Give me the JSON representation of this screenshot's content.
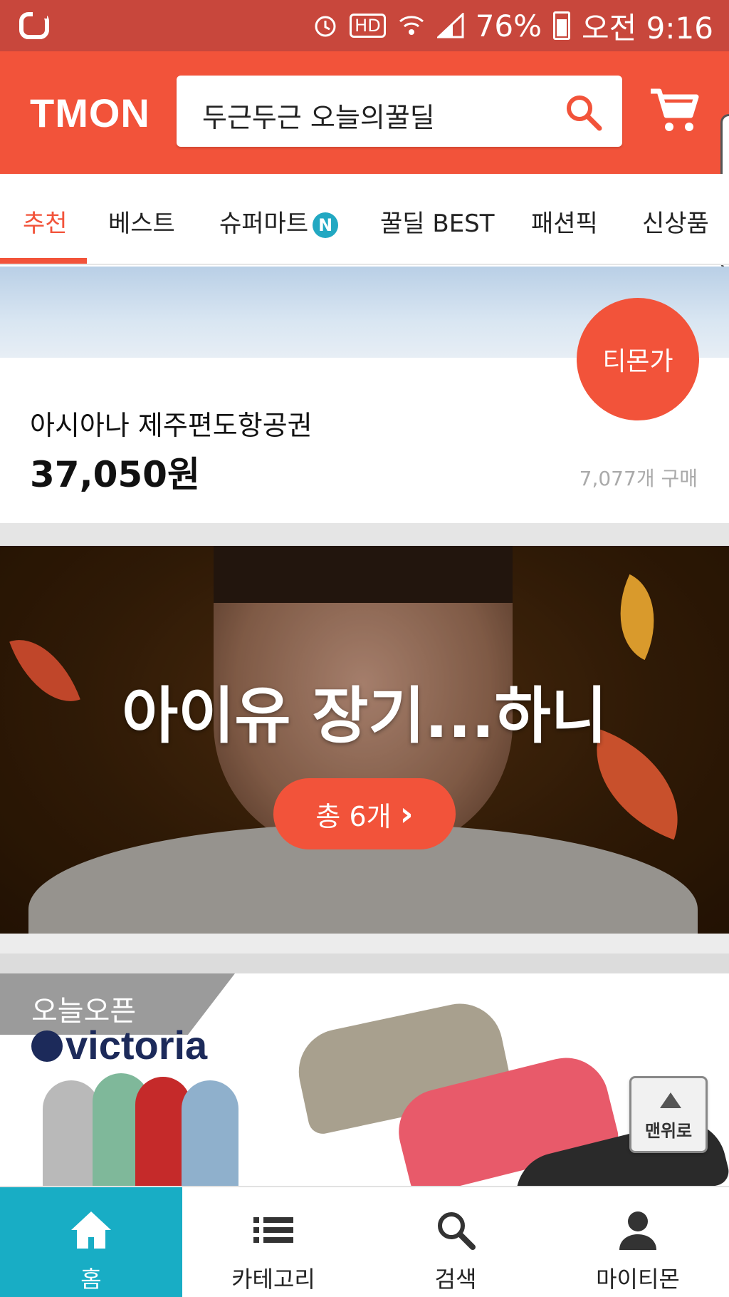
{
  "status_bar": {
    "battery": "76%",
    "time": "오전 9:16",
    "hd_label": "HD"
  },
  "header": {
    "logo": "TMON",
    "search_value": "두근두근 오늘의꿀딜"
  },
  "tabs": [
    {
      "label": "추천"
    },
    {
      "label": "베스트"
    },
    {
      "label": "슈퍼마트",
      "badge": "N"
    },
    {
      "label": "꿀딜 BEST"
    },
    {
      "label": "패션픽"
    },
    {
      "label": "신상품"
    }
  ],
  "deal": {
    "badge": "티몬가",
    "title": "아시아나 제주편도항공권",
    "price": "37,050원",
    "sold": "7,077개 구매"
  },
  "promo": {
    "title": "아이유 장기...하니",
    "button_label": "총 6개",
    "button_arrow": "›"
  },
  "shoes_section": {
    "tag": "오늘오픈",
    "brand": "victoria"
  },
  "top_button": {
    "label": "맨위로"
  },
  "bottom_nav": [
    {
      "label": "홈",
      "icon": "home-icon"
    },
    {
      "label": "카테고리",
      "icon": "list-icon"
    },
    {
      "label": "검색",
      "icon": "search-icon"
    },
    {
      "label": "마이티몬",
      "icon": "person-icon"
    }
  ],
  "colors": {
    "brand": "#f2533a",
    "status_bar": "#c8473c",
    "nav_active": "#18adc5"
  }
}
